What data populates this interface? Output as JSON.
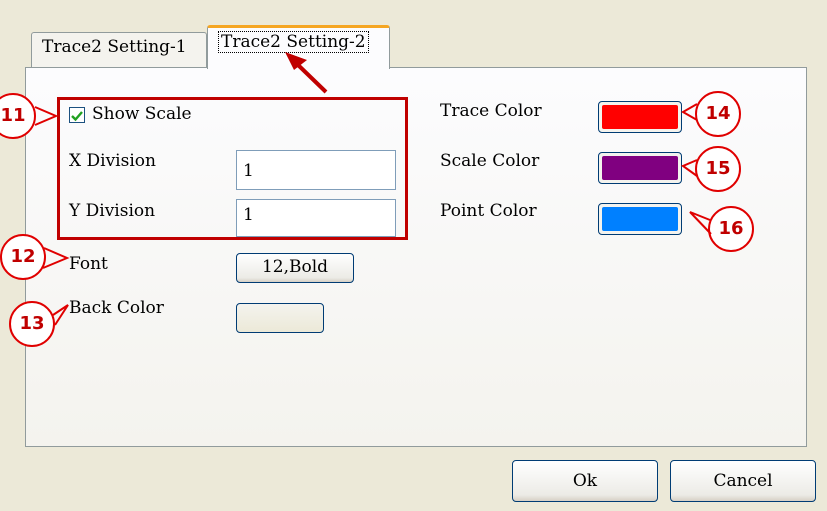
{
  "tabs": [
    {
      "label": "Trace2 Setting-1",
      "active": false
    },
    {
      "label": "Trace2 Setting-2",
      "active": true
    }
  ],
  "left": {
    "show_scale": {
      "label": "Show Scale",
      "checked": true
    },
    "x_division": {
      "label": "X Division",
      "value": "1"
    },
    "y_division": {
      "label": "Y Division",
      "value": "1"
    },
    "font": {
      "label": "Font",
      "button_label": "12,Bold"
    },
    "back_color": {
      "label": "Back Color",
      "color": "#ece9d8"
    }
  },
  "right": {
    "trace_color": {
      "label": "Trace Color",
      "color": "#ff0000"
    },
    "scale_color": {
      "label": "Scale Color",
      "color": "#800080"
    },
    "point_color": {
      "label": "Point Color",
      "color": "#0080ff"
    }
  },
  "buttons": {
    "ok": "Ok",
    "cancel": "Cancel"
  },
  "callouts": [
    "11",
    "12",
    "13",
    "14",
    "15",
    "16"
  ],
  "annotation_color": "#e00000"
}
